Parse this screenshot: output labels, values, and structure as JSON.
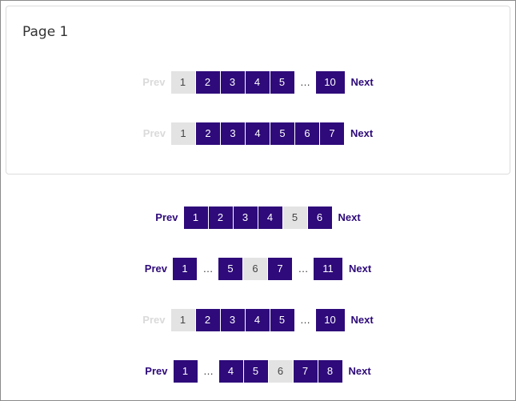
{
  "card": {
    "title": "Page 1"
  },
  "paginations": [
    {
      "prev": {
        "label": "Prev",
        "disabled": true
      },
      "next": {
        "label": "Next",
        "disabled": false
      },
      "items": [
        {
          "label": "1",
          "current": true
        },
        {
          "label": "2"
        },
        {
          "label": "3"
        },
        {
          "label": "4"
        },
        {
          "label": "5"
        },
        {
          "label": "…",
          "ellipsis": true
        },
        {
          "label": "10"
        }
      ]
    },
    {
      "prev": {
        "label": "Prev",
        "disabled": true
      },
      "next": {
        "label": "Next",
        "disabled": false
      },
      "items": [
        {
          "label": "1",
          "current": true
        },
        {
          "label": "2"
        },
        {
          "label": "3"
        },
        {
          "label": "4"
        },
        {
          "label": "5"
        },
        {
          "label": "6"
        },
        {
          "label": "7"
        }
      ]
    },
    {
      "prev": {
        "label": "Prev",
        "disabled": false
      },
      "next": {
        "label": "Next",
        "disabled": false
      },
      "items": [
        {
          "label": "1"
        },
        {
          "label": "2"
        },
        {
          "label": "3"
        },
        {
          "label": "4"
        },
        {
          "label": "5",
          "current": true
        },
        {
          "label": "6"
        }
      ]
    },
    {
      "prev": {
        "label": "Prev",
        "disabled": false
      },
      "next": {
        "label": "Next",
        "disabled": false
      },
      "items": [
        {
          "label": "1"
        },
        {
          "label": "…",
          "ellipsis": true
        },
        {
          "label": "5"
        },
        {
          "label": "6",
          "current": true
        },
        {
          "label": "7"
        },
        {
          "label": "…",
          "ellipsis": true
        },
        {
          "label": "11"
        }
      ]
    },
    {
      "prev": {
        "label": "Prev",
        "disabled": true
      },
      "next": {
        "label": "Next",
        "disabled": false
      },
      "items": [
        {
          "label": "1",
          "current": true
        },
        {
          "label": "2"
        },
        {
          "label": "3"
        },
        {
          "label": "4"
        },
        {
          "label": "5"
        },
        {
          "label": "…",
          "ellipsis": true
        },
        {
          "label": "10"
        }
      ]
    },
    {
      "prev": {
        "label": "Prev",
        "disabled": false
      },
      "next": {
        "label": "Next",
        "disabled": false
      },
      "items": [
        {
          "label": "1"
        },
        {
          "label": "…",
          "ellipsis": true
        },
        {
          "label": "4"
        },
        {
          "label": "5"
        },
        {
          "label": "6",
          "current": true
        },
        {
          "label": "7"
        },
        {
          "label": "8"
        }
      ]
    }
  ],
  "colors": {
    "active_page_bg": "#2e0a7a",
    "current_page_bg": "#e3e3e3",
    "disabled_nav": "#dadada",
    "nav_text": "#2e0a7a"
  }
}
